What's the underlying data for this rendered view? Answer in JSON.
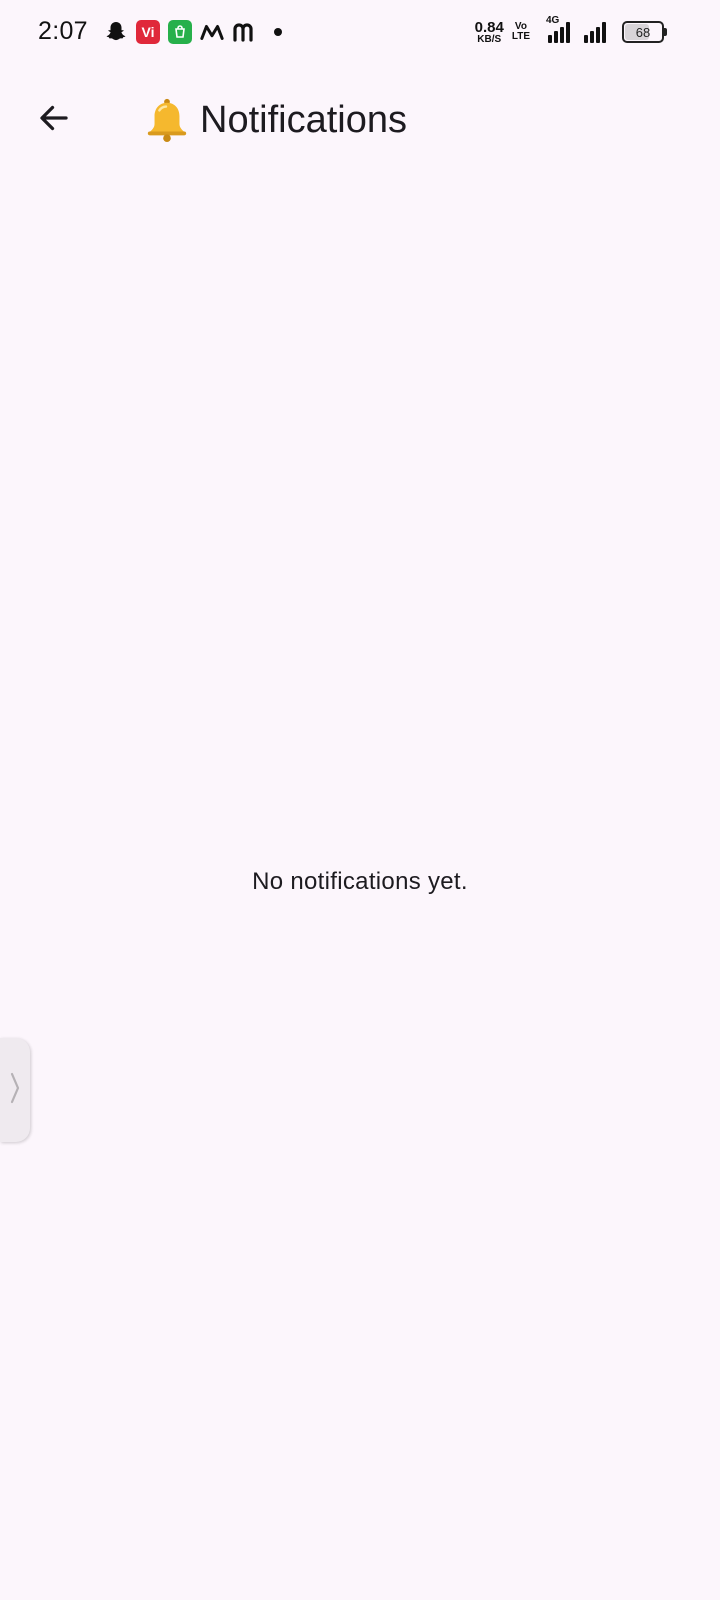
{
  "status_bar": {
    "time": "2:07",
    "notification_icons": [
      "snapchat-icon",
      "vi-app-icon",
      "shopping-bag-icon",
      "myntra-icon",
      "m-app-icon",
      "more-notifications-dot"
    ],
    "vi_label": "Vi",
    "net_speed_value": "0.84",
    "net_speed_unit": "KB/S",
    "volte_top": "Vo",
    "volte_bottom": "LTE",
    "network_type": "4G",
    "battery_level": "68",
    "battery_fraction": 0.68
  },
  "app_bar": {
    "back_icon": "arrow-left-icon",
    "title_emoji_icon": "bell-icon",
    "title": "Notifications"
  },
  "content": {
    "empty_message": "No notifications yet."
  },
  "side_handle": {
    "icon": "chevron-right-icon"
  },
  "colors": {
    "background": "#fcf6fc",
    "text": "#1d1b20",
    "bell": "#f5b82e"
  }
}
